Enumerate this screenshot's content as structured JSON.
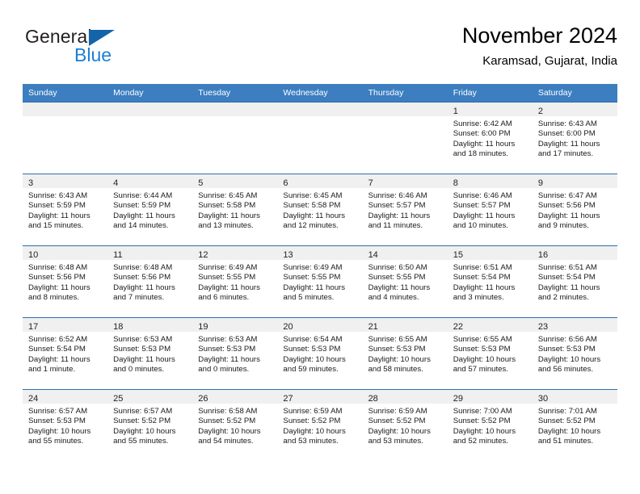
{
  "brand": {
    "name_top": "General",
    "name_bottom": "Blue",
    "triangle_color": "#1464aa",
    "blue_text_color": "#1b7fd4"
  },
  "header": {
    "title": "November 2024",
    "subtitle": "Karamsad, Gujarat, India",
    "accent_color": "#3c7ec0",
    "row_border_color": "#2f6cae",
    "daynum_band_color": "#f0f0f0"
  },
  "weekday_headers": [
    "Sunday",
    "Monday",
    "Tuesday",
    "Wednesday",
    "Thursday",
    "Friday",
    "Saturday"
  ],
  "weeks": [
    [
      {
        "day": "",
        "empty": true,
        "sunrise": "",
        "sunset": "",
        "daylight_1": "",
        "daylight_2": ""
      },
      {
        "day": "",
        "empty": true,
        "sunrise": "",
        "sunset": "",
        "daylight_1": "",
        "daylight_2": ""
      },
      {
        "day": "",
        "empty": true,
        "sunrise": "",
        "sunset": "",
        "daylight_1": "",
        "daylight_2": ""
      },
      {
        "day": "",
        "empty": true,
        "sunrise": "",
        "sunset": "",
        "daylight_1": "",
        "daylight_2": ""
      },
      {
        "day": "",
        "empty": true,
        "sunrise": "",
        "sunset": "",
        "daylight_1": "",
        "daylight_2": ""
      },
      {
        "day": "1",
        "empty": false,
        "sunrise": "Sunrise: 6:42 AM",
        "sunset": "Sunset: 6:00 PM",
        "daylight_1": "Daylight: 11 hours",
        "daylight_2": "and 18 minutes."
      },
      {
        "day": "2",
        "empty": false,
        "sunrise": "Sunrise: 6:43 AM",
        "sunset": "Sunset: 6:00 PM",
        "daylight_1": "Daylight: 11 hours",
        "daylight_2": "and 17 minutes."
      }
    ],
    [
      {
        "day": "3",
        "empty": false,
        "sunrise": "Sunrise: 6:43 AM",
        "sunset": "Sunset: 5:59 PM",
        "daylight_1": "Daylight: 11 hours",
        "daylight_2": "and 15 minutes."
      },
      {
        "day": "4",
        "empty": false,
        "sunrise": "Sunrise: 6:44 AM",
        "sunset": "Sunset: 5:59 PM",
        "daylight_1": "Daylight: 11 hours",
        "daylight_2": "and 14 minutes."
      },
      {
        "day": "5",
        "empty": false,
        "sunrise": "Sunrise: 6:45 AM",
        "sunset": "Sunset: 5:58 PM",
        "daylight_1": "Daylight: 11 hours",
        "daylight_2": "and 13 minutes."
      },
      {
        "day": "6",
        "empty": false,
        "sunrise": "Sunrise: 6:45 AM",
        "sunset": "Sunset: 5:58 PM",
        "daylight_1": "Daylight: 11 hours",
        "daylight_2": "and 12 minutes."
      },
      {
        "day": "7",
        "empty": false,
        "sunrise": "Sunrise: 6:46 AM",
        "sunset": "Sunset: 5:57 PM",
        "daylight_1": "Daylight: 11 hours",
        "daylight_2": "and 11 minutes."
      },
      {
        "day": "8",
        "empty": false,
        "sunrise": "Sunrise: 6:46 AM",
        "sunset": "Sunset: 5:57 PM",
        "daylight_1": "Daylight: 11 hours",
        "daylight_2": "and 10 minutes."
      },
      {
        "day": "9",
        "empty": false,
        "sunrise": "Sunrise: 6:47 AM",
        "sunset": "Sunset: 5:56 PM",
        "daylight_1": "Daylight: 11 hours",
        "daylight_2": "and 9 minutes."
      }
    ],
    [
      {
        "day": "10",
        "empty": false,
        "sunrise": "Sunrise: 6:48 AM",
        "sunset": "Sunset: 5:56 PM",
        "daylight_1": "Daylight: 11 hours",
        "daylight_2": "and 8 minutes."
      },
      {
        "day": "11",
        "empty": false,
        "sunrise": "Sunrise: 6:48 AM",
        "sunset": "Sunset: 5:56 PM",
        "daylight_1": "Daylight: 11 hours",
        "daylight_2": "and 7 minutes."
      },
      {
        "day": "12",
        "empty": false,
        "sunrise": "Sunrise: 6:49 AM",
        "sunset": "Sunset: 5:55 PM",
        "daylight_1": "Daylight: 11 hours",
        "daylight_2": "and 6 minutes."
      },
      {
        "day": "13",
        "empty": false,
        "sunrise": "Sunrise: 6:49 AM",
        "sunset": "Sunset: 5:55 PM",
        "daylight_1": "Daylight: 11 hours",
        "daylight_2": "and 5 minutes."
      },
      {
        "day": "14",
        "empty": false,
        "sunrise": "Sunrise: 6:50 AM",
        "sunset": "Sunset: 5:55 PM",
        "daylight_1": "Daylight: 11 hours",
        "daylight_2": "and 4 minutes."
      },
      {
        "day": "15",
        "empty": false,
        "sunrise": "Sunrise: 6:51 AM",
        "sunset": "Sunset: 5:54 PM",
        "daylight_1": "Daylight: 11 hours",
        "daylight_2": "and 3 minutes."
      },
      {
        "day": "16",
        "empty": false,
        "sunrise": "Sunrise: 6:51 AM",
        "sunset": "Sunset: 5:54 PM",
        "daylight_1": "Daylight: 11 hours",
        "daylight_2": "and 2 minutes."
      }
    ],
    [
      {
        "day": "17",
        "empty": false,
        "sunrise": "Sunrise: 6:52 AM",
        "sunset": "Sunset: 5:54 PM",
        "daylight_1": "Daylight: 11 hours",
        "daylight_2": "and 1 minute."
      },
      {
        "day": "18",
        "empty": false,
        "sunrise": "Sunrise: 6:53 AM",
        "sunset": "Sunset: 5:53 PM",
        "daylight_1": "Daylight: 11 hours",
        "daylight_2": "and 0 minutes."
      },
      {
        "day": "19",
        "empty": false,
        "sunrise": "Sunrise: 6:53 AM",
        "sunset": "Sunset: 5:53 PM",
        "daylight_1": "Daylight: 11 hours",
        "daylight_2": "and 0 minutes."
      },
      {
        "day": "20",
        "empty": false,
        "sunrise": "Sunrise: 6:54 AM",
        "sunset": "Sunset: 5:53 PM",
        "daylight_1": "Daylight: 10 hours",
        "daylight_2": "and 59 minutes."
      },
      {
        "day": "21",
        "empty": false,
        "sunrise": "Sunrise: 6:55 AM",
        "sunset": "Sunset: 5:53 PM",
        "daylight_1": "Daylight: 10 hours",
        "daylight_2": "and 58 minutes."
      },
      {
        "day": "22",
        "empty": false,
        "sunrise": "Sunrise: 6:55 AM",
        "sunset": "Sunset: 5:53 PM",
        "daylight_1": "Daylight: 10 hours",
        "daylight_2": "and 57 minutes."
      },
      {
        "day": "23",
        "empty": false,
        "sunrise": "Sunrise: 6:56 AM",
        "sunset": "Sunset: 5:53 PM",
        "daylight_1": "Daylight: 10 hours",
        "daylight_2": "and 56 minutes."
      }
    ],
    [
      {
        "day": "24",
        "empty": false,
        "sunrise": "Sunrise: 6:57 AM",
        "sunset": "Sunset: 5:53 PM",
        "daylight_1": "Daylight: 10 hours",
        "daylight_2": "and 55 minutes."
      },
      {
        "day": "25",
        "empty": false,
        "sunrise": "Sunrise: 6:57 AM",
        "sunset": "Sunset: 5:52 PM",
        "daylight_1": "Daylight: 10 hours",
        "daylight_2": "and 55 minutes."
      },
      {
        "day": "26",
        "empty": false,
        "sunrise": "Sunrise: 6:58 AM",
        "sunset": "Sunset: 5:52 PM",
        "daylight_1": "Daylight: 10 hours",
        "daylight_2": "and 54 minutes."
      },
      {
        "day": "27",
        "empty": false,
        "sunrise": "Sunrise: 6:59 AM",
        "sunset": "Sunset: 5:52 PM",
        "daylight_1": "Daylight: 10 hours",
        "daylight_2": "and 53 minutes."
      },
      {
        "day": "28",
        "empty": false,
        "sunrise": "Sunrise: 6:59 AM",
        "sunset": "Sunset: 5:52 PM",
        "daylight_1": "Daylight: 10 hours",
        "daylight_2": "and 53 minutes."
      },
      {
        "day": "29",
        "empty": false,
        "sunrise": "Sunrise: 7:00 AM",
        "sunset": "Sunset: 5:52 PM",
        "daylight_1": "Daylight: 10 hours",
        "daylight_2": "and 52 minutes."
      },
      {
        "day": "30",
        "empty": false,
        "sunrise": "Sunrise: 7:01 AM",
        "sunset": "Sunset: 5:52 PM",
        "daylight_1": "Daylight: 10 hours",
        "daylight_2": "and 51 minutes."
      }
    ]
  ]
}
